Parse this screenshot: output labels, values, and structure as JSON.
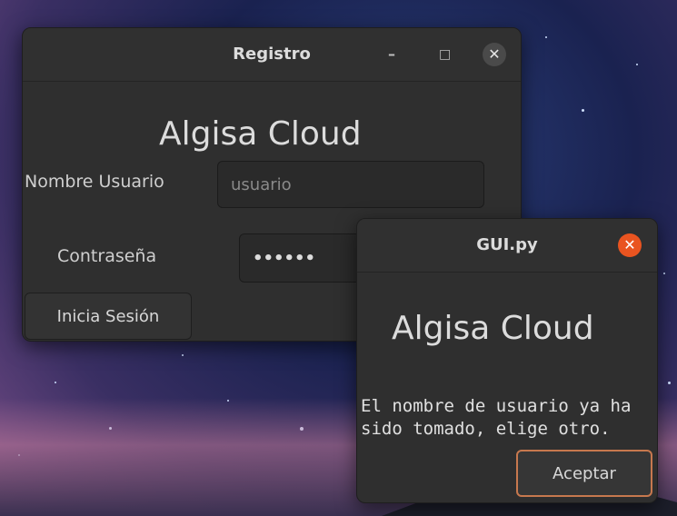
{
  "main_window": {
    "title": "Registro",
    "minimize_glyph": "–",
    "maximize_glyph": "□",
    "close_glyph": "✕",
    "brand": "Algisa Cloud",
    "username_label": "Nombre Usuario",
    "username_placeholder": "usuario",
    "password_label": "Contraseña",
    "password_value": "••••••",
    "login_button": "Inicia Sesión"
  },
  "dialog": {
    "title": "GUI.py",
    "close_glyph": "✕",
    "brand": "Algisa Cloud",
    "message_line1": "El nombre de usuario ya ha",
    "message_line2": "sido tomado, elige otro.",
    "accept_button": "Aceptar"
  },
  "colors": {
    "close_accent": "#e95420",
    "dialog_button_border": "#c7784e"
  }
}
